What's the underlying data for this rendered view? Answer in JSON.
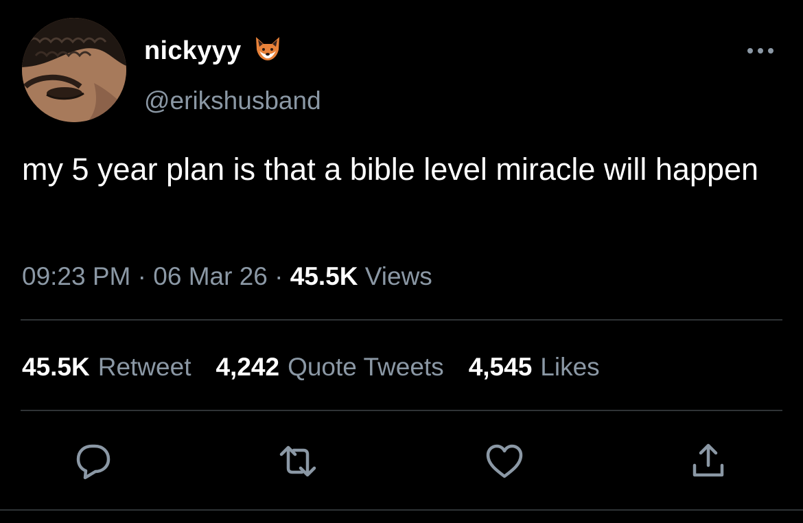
{
  "author": {
    "display_name": "nickyyy",
    "emoji_icon": "fox-face-emoji",
    "handle": "@erikshusband"
  },
  "tweet": {
    "text": "my 5 year plan is that a bible level miracle will happen"
  },
  "meta": {
    "time": "09:23 PM",
    "separator1": "·",
    "date": "06 Mar 26",
    "separator2": "·",
    "views_count": "45.5K",
    "views_label": "Views"
  },
  "stats": {
    "retweets_count": "45.5K",
    "retweets_label": "Retweet",
    "quotes_count": "4,242",
    "quotes_label": "Quote Tweets",
    "likes_count": "4,545",
    "likes_label": "Likes"
  },
  "actions": {
    "reply_icon": "reply-icon",
    "retweet_icon": "retweet-icon",
    "like_icon": "heart-icon",
    "share_icon": "share-icon"
  },
  "colors": {
    "background": "#000000",
    "text_primary": "#ffffff",
    "text_secondary": "#8b98a5",
    "divider": "#2f3336"
  }
}
